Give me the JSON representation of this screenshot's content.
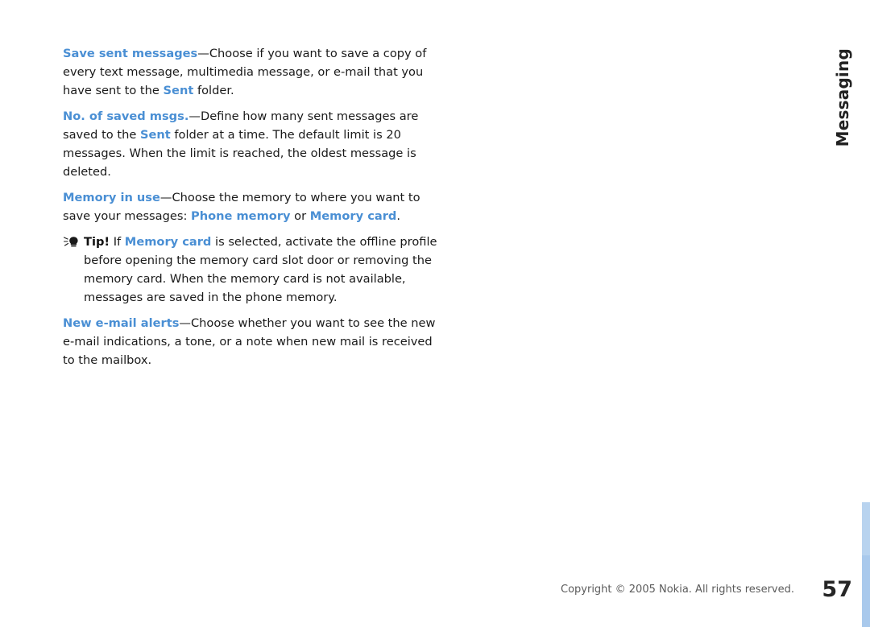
{
  "chapter": {
    "title": "Messaging"
  },
  "body": {
    "paragraphs": [
      {
        "id": "save-sent-messages",
        "term": "Save sent messages",
        "parts": [
          {
            "text": "Save sent messages",
            "style": "blue"
          },
          {
            "text": "—Choose if you want to save a copy of every text message, multimedia message, or e-mail that you have sent to the ",
            "style": "plain"
          },
          {
            "text": "Sent",
            "style": "blue"
          },
          {
            "text": " folder.",
            "style": "plain"
          }
        ]
      },
      {
        "id": "no-of-saved-msgs",
        "term": "No. of saved msgs.",
        "parts": [
          {
            "text": "No. of saved msgs.",
            "style": "blue"
          },
          {
            "text": "—Define how many sent messages are saved to the ",
            "style": "plain"
          },
          {
            "text": "Sent",
            "style": "blue"
          },
          {
            "text": " folder at a time. The default limit is 20 messages. When the limit is reached, the oldest message is deleted.",
            "style": "plain"
          }
        ]
      },
      {
        "id": "memory-in-use",
        "term": "Memory in use",
        "parts": [
          {
            "text": "Memory in use",
            "style": "blue"
          },
          {
            "text": "—Choose the memory to where you want to save your messages: ",
            "style": "plain"
          },
          {
            "text": "Phone memory",
            "style": "blue"
          },
          {
            "text": " or ",
            "style": "plain"
          },
          {
            "text": "Memory card",
            "style": "blue"
          },
          {
            "text": ".",
            "style": "plain"
          }
        ]
      },
      {
        "id": "new-e-mail-alerts",
        "term": "New e-mail alerts",
        "parts": [
          {
            "text": "New e-mail alerts",
            "style": "blue"
          },
          {
            "text": "—Choose whether you want to see the new e-mail indications, a tone, or a note when new mail is received to the mailbox.",
            "style": "plain"
          }
        ]
      }
    ],
    "tip": {
      "label": "Tip!",
      "parts": [
        {
          "text": "Tip!",
          "style": "bold"
        },
        {
          "text": " If ",
          "style": "plain"
        },
        {
          "text": "Memory card",
          "style": "blue"
        },
        {
          "text": " is selected, activate the offline profile before opening the memory card slot door or removing the memory card. When the memory card is not available, messages are saved in the phone memory.",
          "style": "plain"
        }
      ]
    }
  },
  "footer": {
    "copyright": "Copyright © 2005 Nokia. All rights reserved.",
    "page_number": "57"
  },
  "colors": {
    "accent_blue": "#4a8fd4",
    "edge_band": "#b8d3ef",
    "edge_band_lower": "#a9c9ec"
  }
}
